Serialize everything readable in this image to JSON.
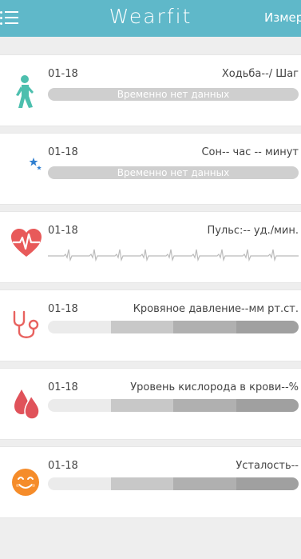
{
  "header": {
    "title": "Wearfit",
    "measure_label": "Измерение",
    "bg_color": "#5fb8c9"
  },
  "cards": [
    {
      "id": "walking",
      "date": "01-18",
      "label": "Ходьба--/ Шаг",
      "bar_text": "Временно нет данных",
      "icon": "walking-person-icon",
      "icon_color": "#4dbfae"
    },
    {
      "id": "sleep",
      "date": "01-18",
      "label": "Сон-- час -- минут",
      "bar_text": "Временно нет данных",
      "icon": "moon-stars-icon",
      "icon_color": "#2f7fd0"
    },
    {
      "id": "pulse",
      "date": "01-18",
      "label": "Пульс:-- уд./мин.",
      "icon": "heart-pulse-icon",
      "icon_color": "#e85a5a"
    },
    {
      "id": "pressure",
      "date": "01-18",
      "label": "Кровяное давление--мм рт.ст.",
      "icon": "stethoscope-icon",
      "icon_color": "#e8625f"
    },
    {
      "id": "oxygen",
      "date": "01-18",
      "label": "Уровень кислорода в крови--%",
      "icon": "blood-drops-icon",
      "icon_color": "#e0525a"
    },
    {
      "id": "fatigue",
      "date": "01-18",
      "label": "Усталость--",
      "icon": "smiley-face-icon",
      "icon_color": "#f58c2a"
    }
  ],
  "segment_colors": [
    "#ebebeb",
    "#c8c8c8",
    "#b0b0b0",
    "#a0a0a0"
  ]
}
